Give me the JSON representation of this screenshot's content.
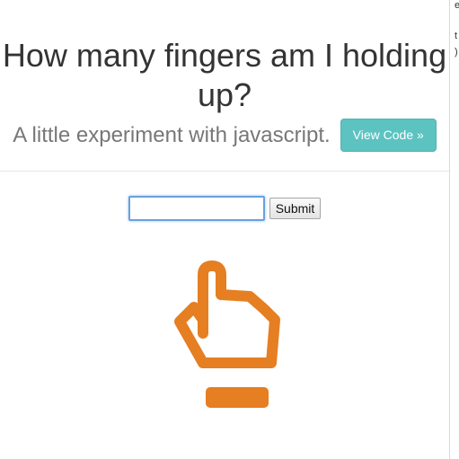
{
  "header": {
    "title": "How many fingers am I holding up?",
    "subtitle": "A little experiment with javascript.",
    "view_code_label": "View Code »"
  },
  "form": {
    "input_value": "",
    "input_placeholder": "",
    "submit_label": "Submit"
  },
  "hand": {
    "icon": "pointing-hand-icon",
    "fingers_shown": 1,
    "color": "#e67e22"
  },
  "colors": {
    "accent_button": "#5cc3c1",
    "hand": "#e67e22",
    "title_text": "#333333",
    "subtitle_text": "#777777"
  }
}
